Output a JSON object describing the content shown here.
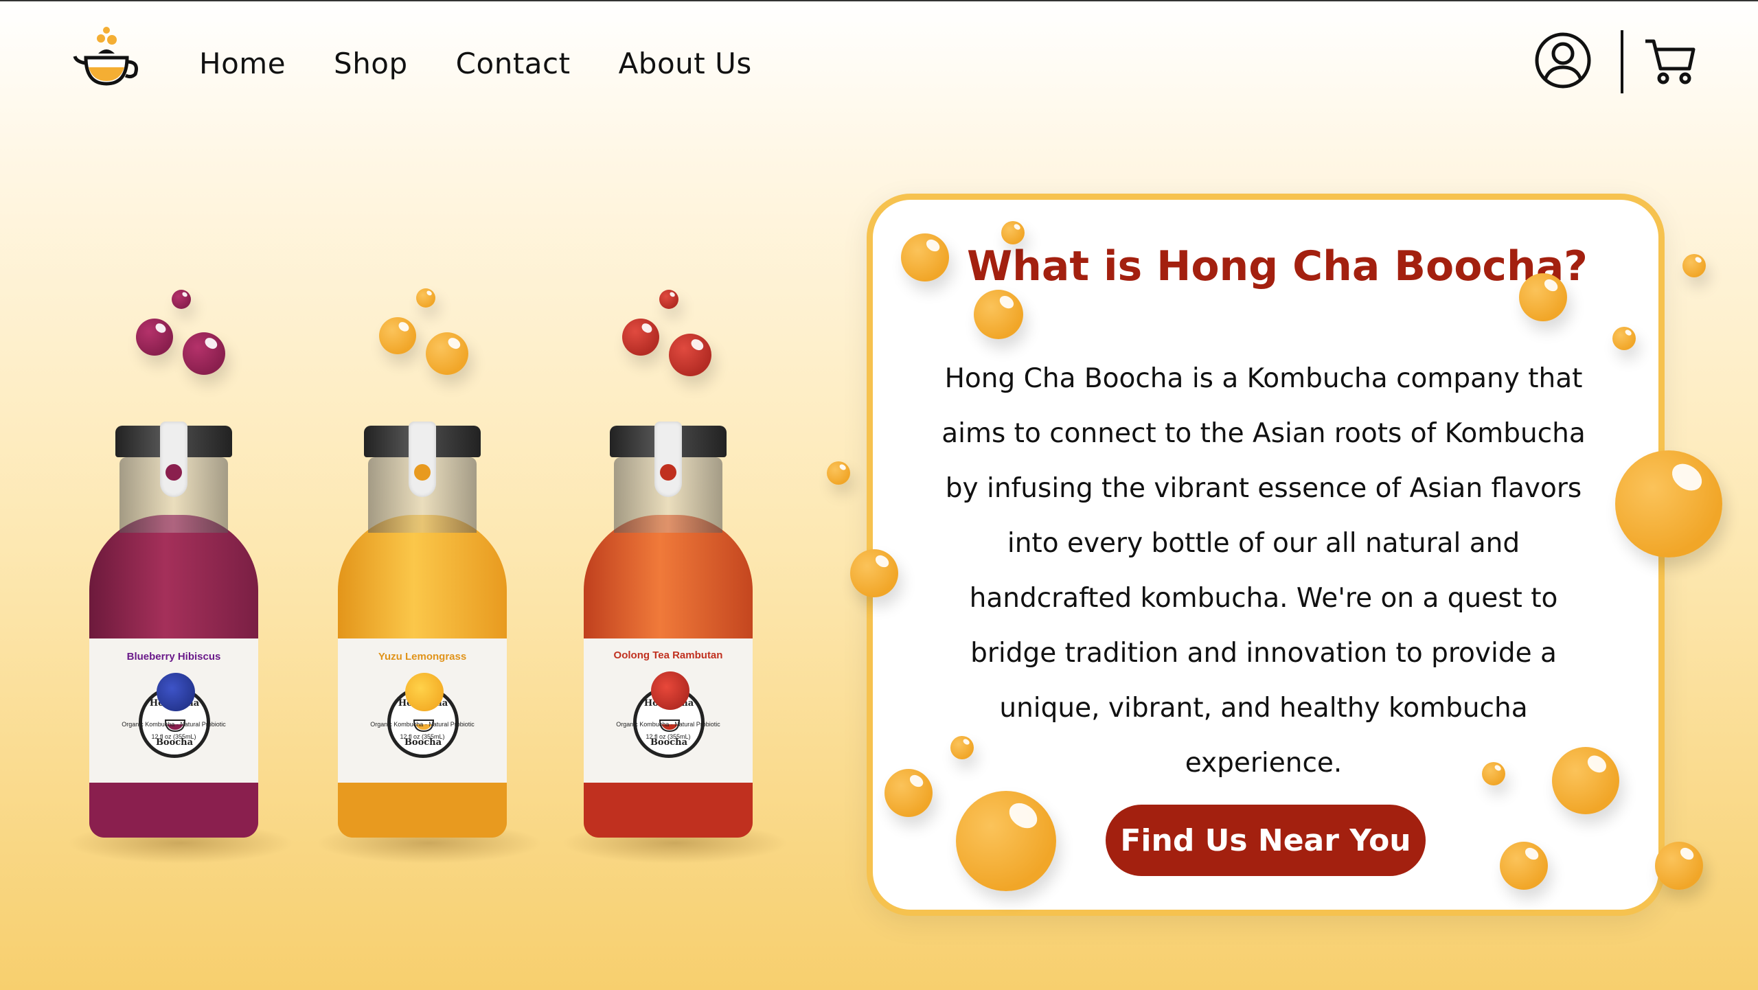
{
  "nav": {
    "items": [
      "Home",
      "Shop",
      "Contact",
      "About Us"
    ]
  },
  "icons": {
    "logo": "teapot-logo-icon",
    "user": "user-circle-icon",
    "cart": "shopping-cart-icon"
  },
  "products": [
    {
      "brand_top": "Hong Cha",
      "brand_bottom": "Boocha",
      "flavor": "Blueberry Hibiscus",
      "tagline": "Organic Kombucha · Natural Probiotic",
      "size": "12 fl oz (355mL)",
      "color": "#8a1f4e"
    },
    {
      "brand_top": "Hong Cha",
      "brand_bottom": "Boocha",
      "flavor": "Yuzu Lemongrass",
      "tagline": "Organic Kombucha · Natural Probiotic",
      "size": "12 fl oz (355mL)",
      "color": "#e0931a"
    },
    {
      "brand_top": "Hong Cha",
      "brand_bottom": "Boocha",
      "flavor": "Oolong Tea Rambutan",
      "tagline": "Organic Kombucha · Natural Probiotic",
      "size": "12 fl oz (355mL)",
      "color": "#c0301f"
    }
  ],
  "about": {
    "title": "What is Hong Cha Boocha?",
    "body": "Hong Cha Boocha is a Kombucha company that aims to connect to the Asian roots of Kombucha by infusing the vibrant essence of Asian flavors into every bottle of our all natural and handcrafted kombucha. We're on a quest to bridge tradition and innovation to provide a unique, vibrant, and healthy kombucha experience.",
    "cta_label": "Find Us Near You"
  },
  "colors": {
    "accent": "#a3200f",
    "card_border": "#f6c24f",
    "bubble_orange": "#f4ae33"
  }
}
